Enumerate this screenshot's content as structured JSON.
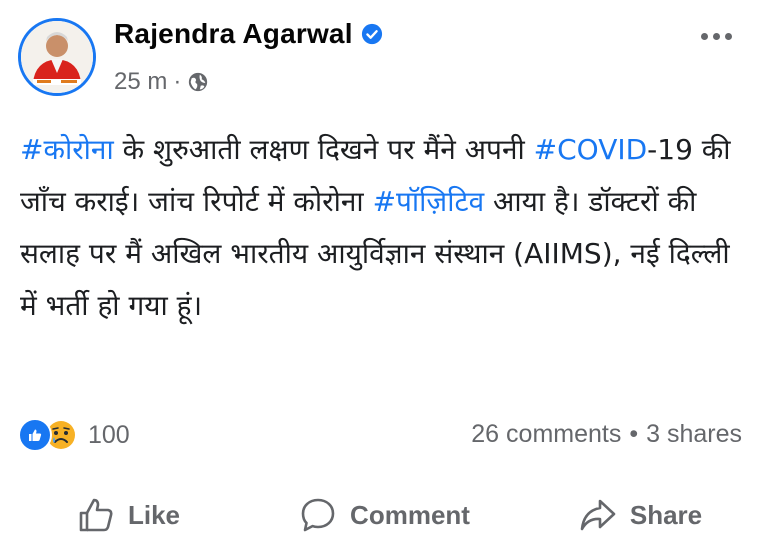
{
  "post": {
    "author": "Rajendra Agarwal",
    "time": "25 m",
    "audience_icon": "globe-icon",
    "verified_icon": "verified-badge-icon",
    "text_segments": [
      {
        "text": "#कोरोना",
        "tag": true
      },
      {
        "text": " के शुरुआती लक्षण दिखने पर मैंने अपनी ",
        "tag": false
      },
      {
        "text": "#COVID",
        "tag": true
      },
      {
        "text": "-19 की जाँच कराई। जांच रिपोर्ट में कोरोना ",
        "tag": false
      },
      {
        "text": "#पॉज़िटिव",
        "tag": true
      },
      {
        "text": " आया है। डॉक्टरों की सलाह पर मैं अखिल भारतीय आयुर्विज्ञान संस्थान (AIIMS), नई दिल्ली में भर्ती हो गया हूं।",
        "tag": false
      }
    ]
  },
  "stats": {
    "reaction_count": "100",
    "comments": "26 comments",
    "separator": "•",
    "shares": "3 shares"
  },
  "actions": {
    "like": "Like",
    "comment": "Comment",
    "share": "Share"
  },
  "colors": {
    "accent": "#1877f2",
    "muted": "#65676b",
    "text": "#1c1e21"
  }
}
